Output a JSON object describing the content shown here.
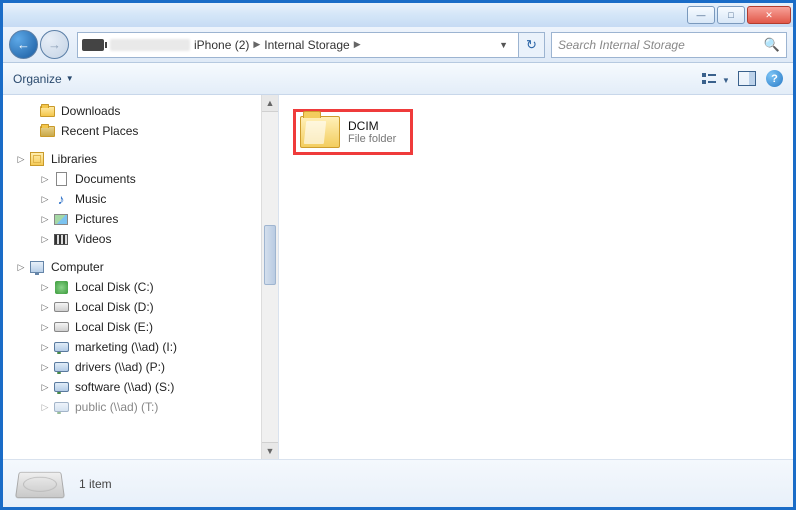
{
  "titlebar": {
    "min_tip": "Minimize",
    "max_tip": "Maximize",
    "close_tip": "Close"
  },
  "address": {
    "crumb1": "iPhone (2)",
    "crumb2": "Internal Storage"
  },
  "refresh_label": "Refresh",
  "search": {
    "placeholder": "Search Internal Storage"
  },
  "toolbar": {
    "organize": "Organize"
  },
  "sidebar": {
    "downloads": "Downloads",
    "recent": "Recent Places",
    "libraries": "Libraries",
    "documents": "Documents",
    "music": "Music",
    "pictures": "Pictures",
    "videos": "Videos",
    "computer": "Computer",
    "local_c": "Local Disk (C:)",
    "local_d": "Local Disk (D:)",
    "local_e": "Local Disk (E:)",
    "net_i": "marketing (\\\\ad) (I:)",
    "net_p": "drivers (\\\\ad) (P:)",
    "net_s": "software (\\\\ad) (S:)",
    "net_t": "public (\\\\ad) (T:)"
  },
  "content": {
    "folder_name": "DCIM",
    "folder_type": "File folder"
  },
  "status": {
    "count": "1 item"
  }
}
